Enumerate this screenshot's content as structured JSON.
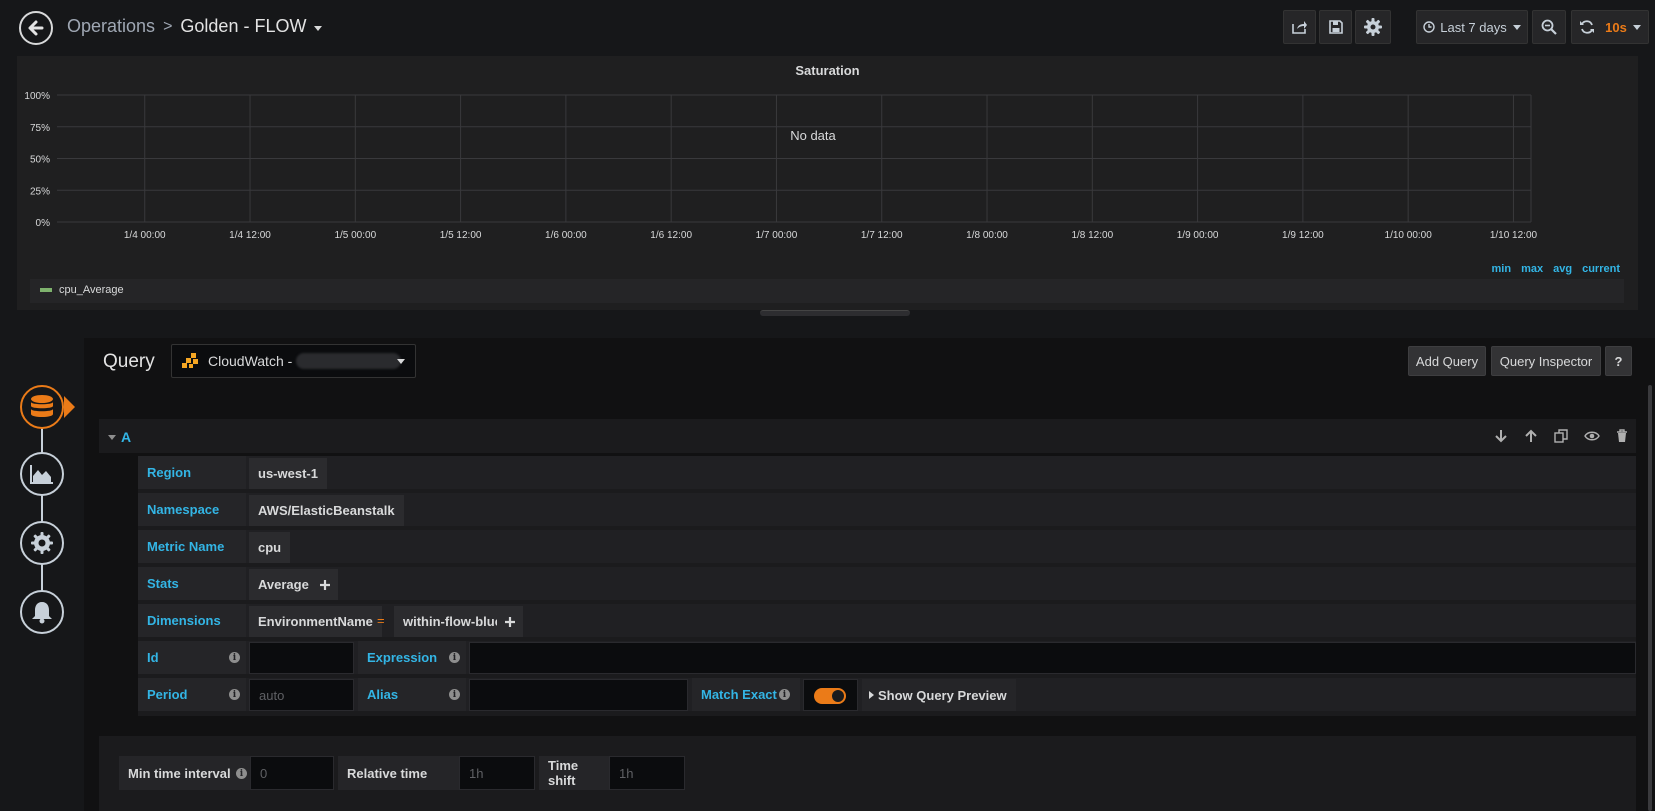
{
  "header": {
    "breadcrumb_parent": "Operations",
    "breadcrumb_separator": ">",
    "dashboard_title": "Golden - FLOW",
    "time_range": "Last 7 days",
    "refresh_interval": "10s"
  },
  "panel": {
    "title": "Saturation",
    "no_data_text": "No data",
    "legend_stats": [
      "min",
      "max",
      "avg",
      "current"
    ]
  },
  "chart_data": {
    "type": "line",
    "title": "Saturation",
    "y_ticks": [
      "100%",
      "75%",
      "50%",
      "25%",
      "0%"
    ],
    "ylim": [
      0,
      100
    ],
    "x_ticks": [
      "1/4 00:00",
      "1/4 12:00",
      "1/5 00:00",
      "1/5 12:00",
      "1/6 00:00",
      "1/6 12:00",
      "1/7 00:00",
      "1/7 12:00",
      "1/8 00:00",
      "1/8 12:00",
      "1/9 00:00",
      "1/9 12:00",
      "1/10 00:00",
      "1/10 12:00"
    ],
    "series": [
      {
        "name": "cpu_Average",
        "values": [],
        "color": "#7eb26d"
      }
    ],
    "grid": true,
    "legend": "bottom"
  },
  "query": {
    "label": "Query",
    "datasource": "CloudWatch -",
    "add_query": "Add Query",
    "query_inspector": "Query Inspector",
    "help": "?",
    "letter": "A",
    "fields": {
      "region_label": "Region",
      "region_value": "us-west-1",
      "namespace_label": "Namespace",
      "namespace_value": "AWS/ElasticBeanstalk",
      "metric_label": "Metric Name",
      "metric_value": "cpu",
      "stats_label": "Stats",
      "stats_value": "Average",
      "dimensions_label": "Dimensions",
      "dimension_key": "EnvironmentName",
      "dimension_operator": "=",
      "dimension_value": "within-flow-blue",
      "id_label": "Id",
      "expression_label": "Expression",
      "period_label": "Period",
      "period_placeholder": "auto",
      "alias_label": "Alias",
      "match_exact_label": "Match Exact",
      "match_exact_on": true,
      "show_preview": "Show Query Preview"
    }
  },
  "options": {
    "min_interval_label": "Min time interval",
    "min_interval_placeholder": "0",
    "relative_time_label": "Relative time",
    "relative_time_placeholder": "1h",
    "time_shift_label": "Time shift",
    "time_shift_placeholder": "1h"
  },
  "icons": {
    "back": "arrow-left-icon",
    "share": "share-icon",
    "save": "save-icon",
    "settings": "gear-icon",
    "clock": "clock-icon",
    "zoom_out": "zoom-out-icon",
    "refresh": "refresh-icon",
    "rail": [
      "database-icon",
      "area-chart-icon",
      "wrench-gear-icon",
      "bell-icon"
    ],
    "row_tools": [
      "arrow-down-icon",
      "arrow-up-icon",
      "duplicate-icon",
      "eye-icon",
      "trash-icon"
    ]
  },
  "colors": {
    "accent": "#eb7b18",
    "link": "#33b5e5",
    "series": "#7eb26d"
  }
}
